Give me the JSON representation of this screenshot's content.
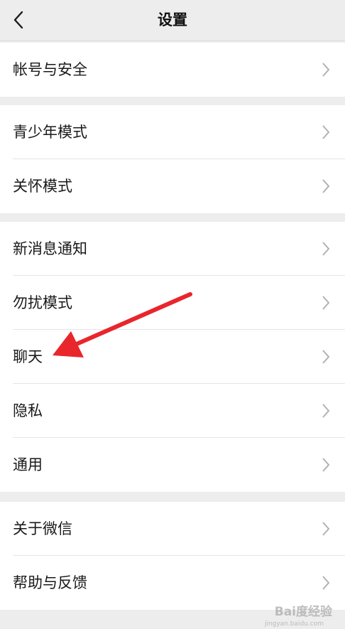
{
  "header": {
    "title": "设置"
  },
  "groups": [
    {
      "items": [
        {
          "label": "帐号与安全"
        }
      ]
    },
    {
      "items": [
        {
          "label": "青少年模式"
        },
        {
          "label": "关怀模式"
        }
      ]
    },
    {
      "items": [
        {
          "label": "新消息通知"
        },
        {
          "label": "勿扰模式"
        },
        {
          "label": "聊天"
        },
        {
          "label": "隐私"
        },
        {
          "label": "通用"
        }
      ]
    },
    {
      "items": [
        {
          "label": "关于微信"
        },
        {
          "label": "帮助与反馈"
        }
      ]
    }
  ],
  "annotation": {
    "color": "#e8262c",
    "points_to": "聊天"
  },
  "watermark": {
    "text": "Bai度经验",
    "subtext": "jingyan.baidu.com"
  },
  "colors": {
    "background": "#ededed",
    "card": "#ffffff",
    "text": "#191919",
    "chevron": "#b2b2b2"
  }
}
